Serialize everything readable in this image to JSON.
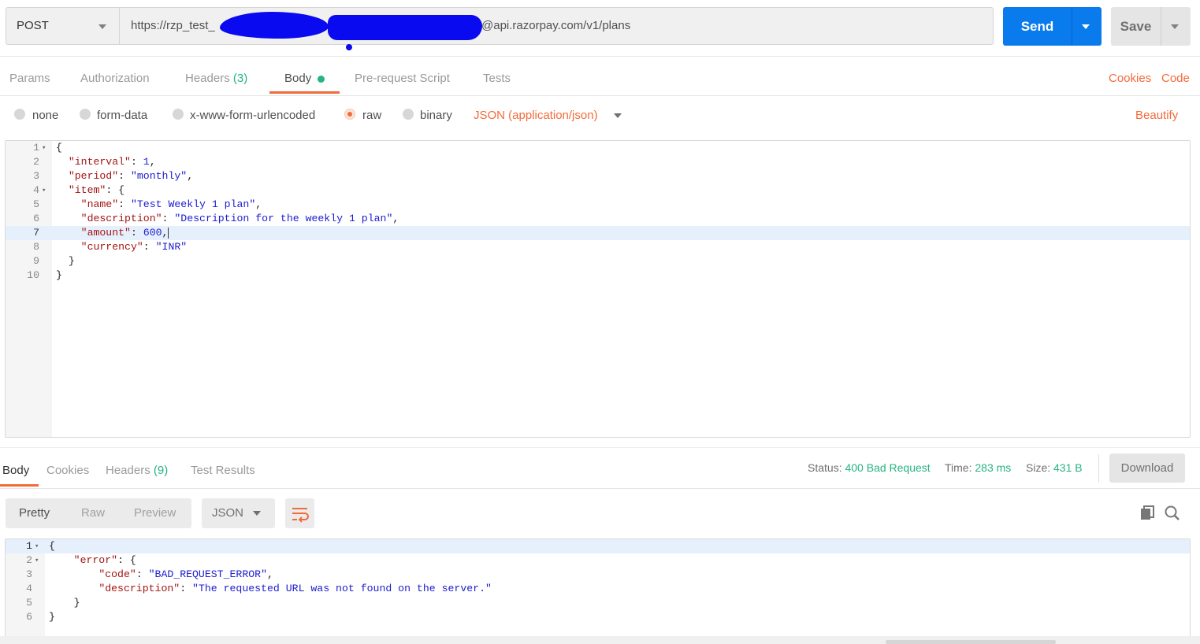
{
  "request": {
    "method": "POST",
    "url_prefix": "https://rzp_test_",
    "url_suffix": "@api.razorpay.com/v1/plans",
    "send_label": "Send",
    "save_label": "Save"
  },
  "request_tabs": {
    "params": "Params",
    "authorization": "Authorization",
    "headers": "Headers",
    "headers_count": "(3)",
    "body": "Body",
    "prerequest": "Pre-request Script",
    "tests": "Tests",
    "cookies": "Cookies",
    "code": "Code"
  },
  "body_types": {
    "none": "none",
    "form_data": "form-data",
    "urlencoded": "x-www-form-urlencoded",
    "raw": "raw",
    "binary": "binary",
    "json_type": "JSON (application/json)",
    "beautify": "Beautify"
  },
  "request_body": [
    [
      "1",
      "{"
    ],
    [
      "2",
      "  \"interval\": 1,"
    ],
    [
      "3",
      "  \"period\": \"monthly\","
    ],
    [
      "4",
      "  \"item\": {"
    ],
    [
      "5",
      "    \"name\": \"Test Weekly 1 plan\","
    ],
    [
      "6",
      "    \"description\": \"Description for the weekly 1 plan\","
    ],
    [
      "7",
      "    \"amount\": 600,"
    ],
    [
      "8",
      "    \"currency\": \"INR\""
    ],
    [
      "9",
      "  }"
    ],
    [
      "10",
      "}"
    ]
  ],
  "response_tabs": {
    "body": "Body",
    "cookies": "Cookies",
    "headers": "Headers",
    "headers_count": "(9)",
    "test_results": "Test Results"
  },
  "response_meta": {
    "status_label": "Status:",
    "status_value": "400 Bad Request",
    "time_label": "Time:",
    "time_value": "283 ms",
    "size_label": "Size:",
    "size_value": "431 B",
    "download": "Download"
  },
  "response_view": {
    "pretty": "Pretty",
    "raw": "Raw",
    "preview": "Preview",
    "format": "JSON"
  },
  "response_body": [
    [
      "1",
      "{"
    ],
    [
      "2",
      "    \"error\": {"
    ],
    [
      "3",
      "        \"code\": \"BAD_REQUEST_ERROR\","
    ],
    [
      "4",
      "        \"description\": \"The requested URL was not found on the server.\""
    ],
    [
      "5",
      "    }"
    ],
    [
      "6",
      "}"
    ]
  ],
  "colors": {
    "accent": "#f26b3a",
    "send": "#097bed",
    "status_green": "#26b47f",
    "redaction": "#0a0af0"
  },
  "icons": [
    "chevron-down-icon",
    "wrap-lines-icon",
    "copy-icon",
    "search-icon"
  ]
}
